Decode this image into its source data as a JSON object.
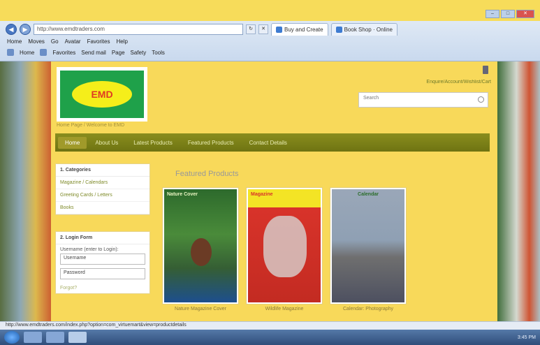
{
  "browser": {
    "address": "http://www.emdtraders.com",
    "tabs": [
      {
        "label": "Buy and Create"
      },
      {
        "label": "Book Shop · Online"
      }
    ],
    "menu": [
      "Home",
      "Moves",
      "Go",
      "Avatar",
      "Favorites",
      "Help"
    ],
    "toolbar": [
      "Home",
      "Favorites",
      "Send mail",
      "Page",
      "Safety",
      "Tools"
    ],
    "status_text": "http://www.emdtraders.com/index.php?option=com_virtuemart&view=productdetails",
    "tray_text": "3:45 PM"
  },
  "site": {
    "logo_text": "EMD",
    "account_link": "Enquire/Account/Wishlist/Cart",
    "search_placeholder": "Search",
    "breadcrumb": "Home Page / Welcome to EMD",
    "nav": [
      {
        "label": "Home",
        "active": true
      },
      {
        "label": "About Us"
      },
      {
        "label": "Latest Products"
      },
      {
        "label": "Featured Products"
      },
      {
        "label": "Contact Details"
      }
    ]
  },
  "sidebar": {
    "categories_title": "1. Categories",
    "categories": [
      "Magazine / Calendars",
      "Greeting Cards / Letters",
      "Books"
    ],
    "login_title": "2. Login Form",
    "username_label": "Username (enter to Login):",
    "username_value": "Username",
    "password_value": "Password",
    "forgot": "Forgot?"
  },
  "main": {
    "section_title": "Featured Products",
    "products": [
      {
        "title": "Nature Magazine Cover",
        "head": "Nature Cover"
      },
      {
        "title": "Wildlife Magazine",
        "head": "Magazine"
      },
      {
        "title": "Calendar: Photography",
        "head": "Calendar"
      }
    ]
  }
}
